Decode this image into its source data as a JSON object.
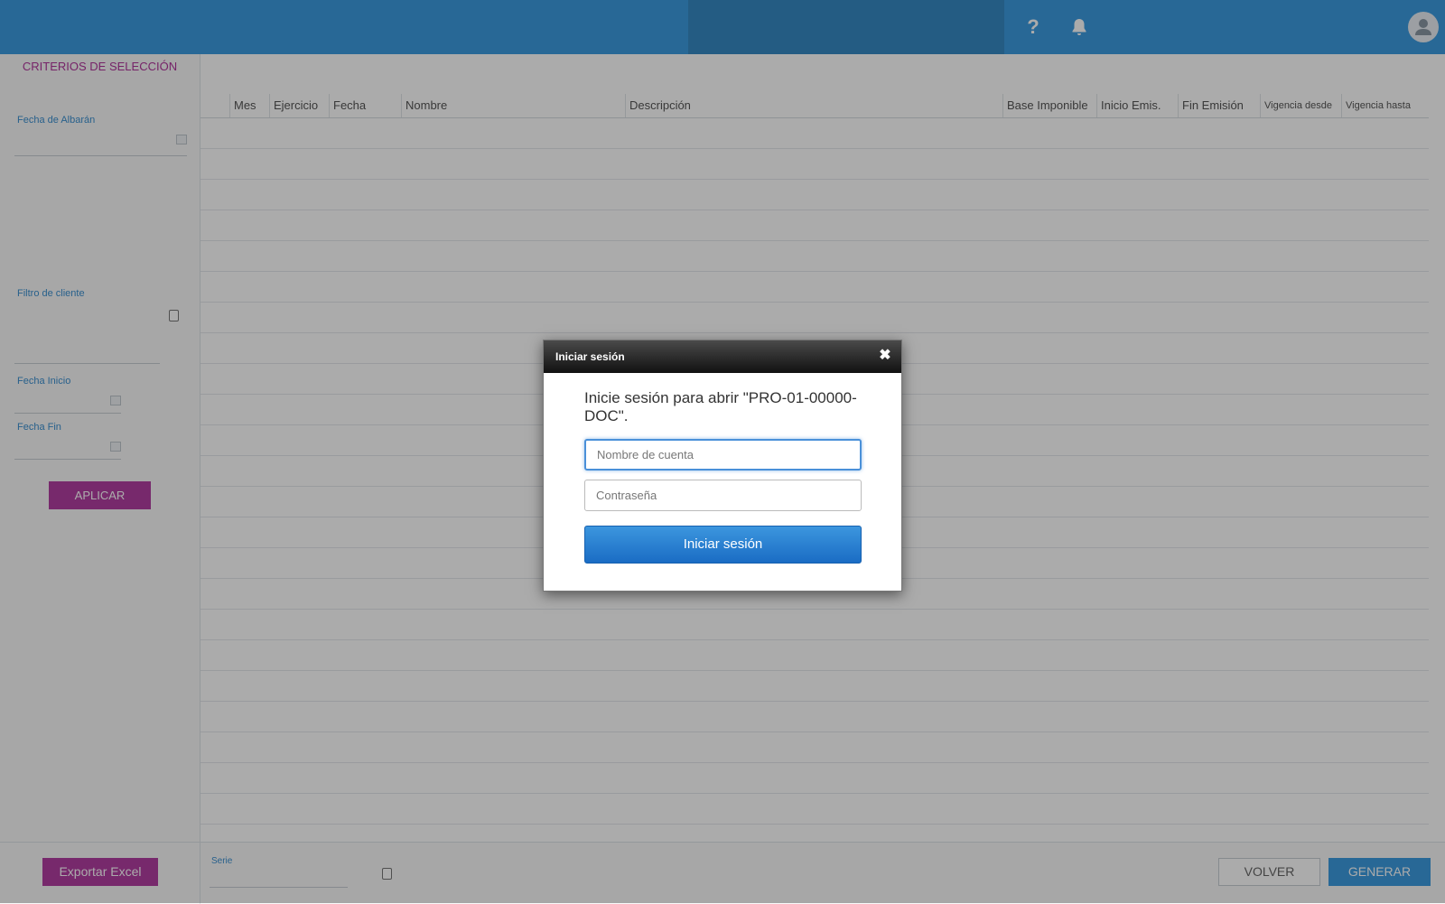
{
  "sidebar": {
    "title": "CRITERIOS DE SELECCIÓN",
    "fecha_albaran_label": "Fecha de Albarán",
    "filtro_cliente_label": "Filtro de cliente",
    "fecha_inicio_label": "Fecha Inicio",
    "fecha_fin_label": "Fecha Fin",
    "apply_label": "APLICAR"
  },
  "grid": {
    "columns": [
      "Mes",
      "Ejercicio",
      "Fecha",
      "Nombre",
      "Descripción",
      "Base Imponible",
      "Inicio Emis.",
      "Fin Emisión",
      "Vigencia desde",
      "Vigencia hasta"
    ]
  },
  "footer": {
    "export_label": "Exportar Excel",
    "serie_label": "Serie",
    "back_label": "VOLVER",
    "generate_label": "GENERAR"
  },
  "modal": {
    "title": "Iniciar sesión",
    "message": "Inicie sesión para abrir \"PRO-01-00000-DOC\".",
    "username_placeholder": "Nombre de cuenta",
    "password_placeholder": "Contraseña",
    "submit_label": "Iniciar sesión"
  },
  "icons": {
    "help": "help-icon",
    "notifications": "bell-icon",
    "user": "user-avatar-icon",
    "close": "close-icon",
    "calendar": "calendar-icon"
  },
  "colors": {
    "topbar": "#3d9ce0",
    "accent_purple": "#b23ea2",
    "primary_blue": "#1a6cc4"
  }
}
